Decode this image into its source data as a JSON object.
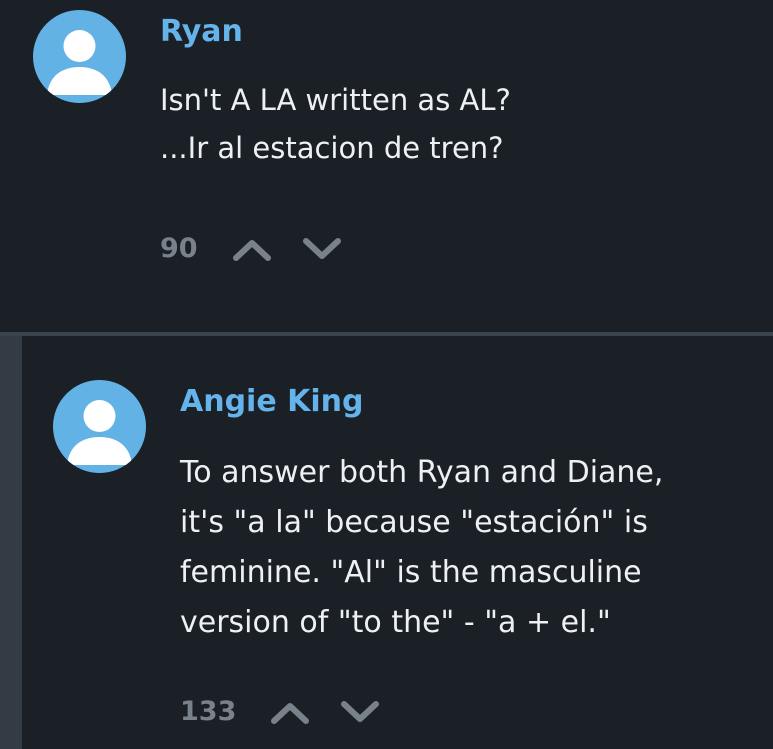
{
  "comments": [
    {
      "author": "Ryan",
      "body_lines": [
        "Isn't A LA written as AL?",
        "...Ir al estacion de tren?"
      ],
      "score": "90",
      "avatar_icon": "user-silhouette-icon",
      "upvote_icon": "chevron-up-icon",
      "downvote_icon": "chevron-down-icon"
    },
    {
      "author": "Angie King",
      "body_lines": [
        "To answer both Ryan and Diane,",
        "it's \"a la\" because \"estación\" is",
        "feminine. \"Al\" is the masculine",
        "version of \"to the\" - \"a + el.\""
      ],
      "score": "133",
      "avatar_icon": "user-silhouette-icon",
      "upvote_icon": "chevron-up-icon",
      "downvote_icon": "chevron-down-icon"
    }
  ],
  "colors": {
    "background": "#1a2026",
    "author": "#64b3ea",
    "body_text": "#eef1f3",
    "muted": "#79828a",
    "avatar_bg": "#63b2e6",
    "avatar_figure": "#ffffff",
    "reply_rail": "#333c44"
  }
}
